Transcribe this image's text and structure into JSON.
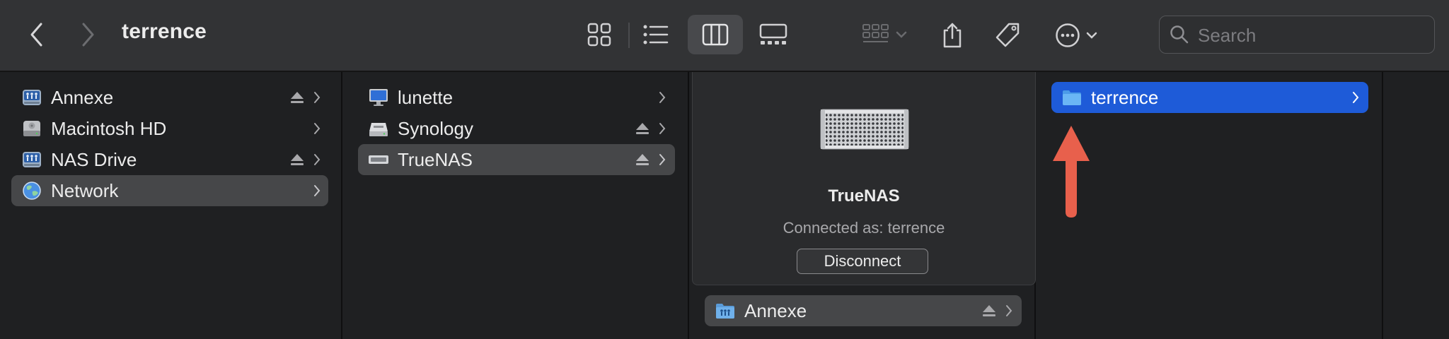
{
  "window": {
    "title": "terrence"
  },
  "toolbar": {
    "back_icon": "chevron-left-icon",
    "forward_icon": "chevron-right-icon",
    "views": [
      "icon-view",
      "list-view",
      "column-view",
      "gallery-view"
    ],
    "active_view": "column-view",
    "search_placeholder": "Search"
  },
  "sidebar": {
    "items": [
      {
        "label": "Annexe",
        "icon": "network-volume-icon",
        "eject": true,
        "chevron": true,
        "selected": false
      },
      {
        "label": "Macintosh HD",
        "icon": "hard-drive-icon",
        "eject": false,
        "chevron": true,
        "selected": false
      },
      {
        "label": "NAS Drive",
        "icon": "network-volume-icon",
        "eject": true,
        "chevron": true,
        "selected": false
      },
      {
        "label": "Network",
        "icon": "globe-icon",
        "eject": false,
        "chevron": true,
        "selected": true
      }
    ]
  },
  "network_column": {
    "items": [
      {
        "label": "lunette",
        "icon": "imac-icon",
        "eject": false,
        "selected": false
      },
      {
        "label": "Synology",
        "icon": "nas-server-icon",
        "eject": true,
        "selected": false
      },
      {
        "label": "TrueNAS",
        "icon": "generic-server-icon",
        "eject": true,
        "selected": true
      }
    ]
  },
  "preview": {
    "name": "TrueNAS",
    "connected_as": "Connected as: terrence",
    "disconnect_label": "Disconnect",
    "share_row": {
      "label": "Annexe",
      "eject": true
    }
  },
  "share_column": {
    "items": [
      {
        "label": "terrence",
        "icon": "folder-icon",
        "selected": true
      }
    ]
  },
  "colors": {
    "selection_blue": "#1e5bd8",
    "selection_gray": "#464749",
    "annotation_arrow": "#e8604c"
  }
}
